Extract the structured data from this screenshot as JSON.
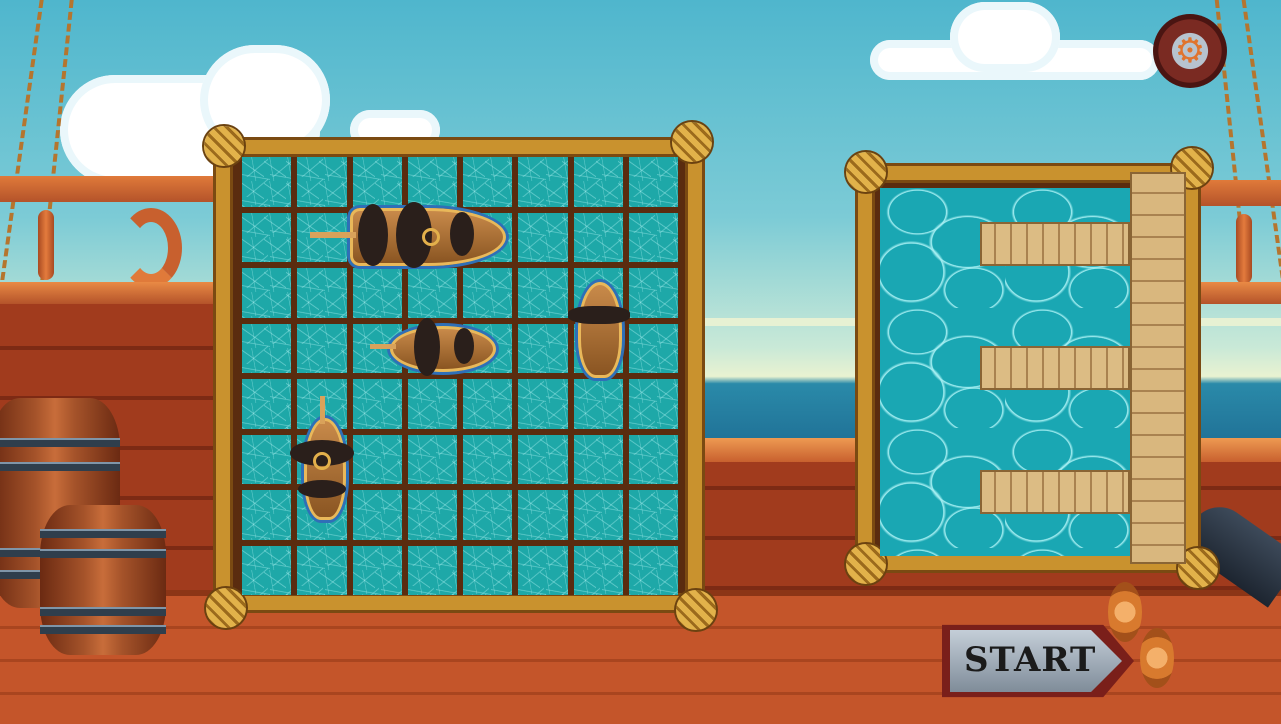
{
  "game": {
    "start_label": "START",
    "settings_icon": "gear-icon",
    "grid": {
      "rows": 8,
      "cols": 8
    },
    "ships": [
      {
        "name": "galleon-large",
        "orientation": "horizontal",
        "length_cells": 3,
        "row": 2,
        "col": 2
      },
      {
        "name": "galleon-medium",
        "orientation": "horizontal",
        "length_cells": 2,
        "row": 4,
        "col": 3
      },
      {
        "name": "rowboat-vertical",
        "orientation": "vertical",
        "length_cells": 2,
        "row": 3,
        "col": 7
      },
      {
        "name": "galleon-vertical",
        "orientation": "vertical",
        "length_cells": 2,
        "row": 6,
        "col": 2
      }
    ],
    "ship_slots": 3,
    "colors": {
      "water": "#1ea8a8",
      "frame": "#c9922e",
      "deck": "#c4552a",
      "start_text": "#1b1b1b"
    }
  }
}
